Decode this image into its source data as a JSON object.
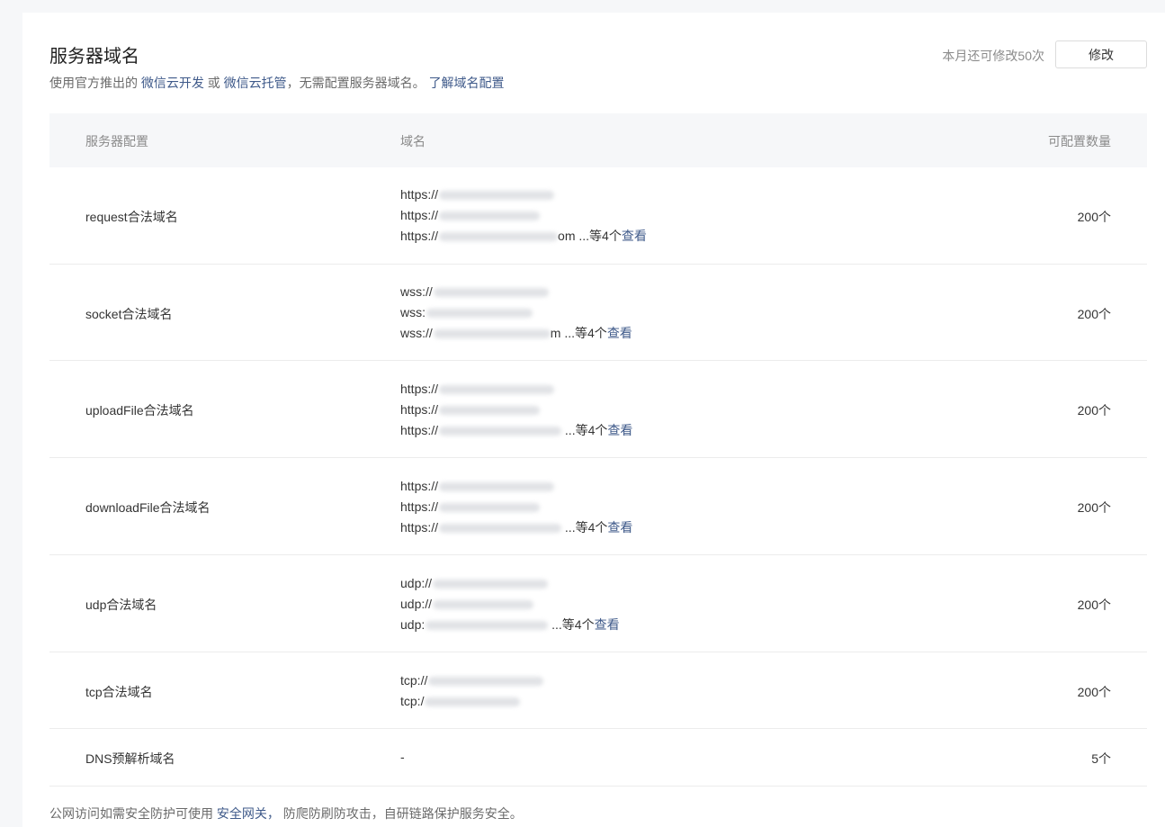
{
  "header": {
    "title": "服务器域名",
    "subtitle_prefix": "使用官方推出的",
    "link_cloud_dev": "微信云开发",
    "or_text": "或",
    "link_cloud_hosting": "微信云托管",
    "subtitle_suffix": "，无需配置服务器域名。",
    "link_learn": "了解域名配置",
    "quota_text": "本月还可修改50次",
    "edit_label": "修改"
  },
  "table": {
    "headers": {
      "config": "服务器配置",
      "domain": "域名",
      "count": "可配置数量"
    },
    "rows": [
      {
        "name": "request合法域名",
        "domains": [
          "https://",
          "https://",
          "https://"
        ],
        "tail": "om",
        "more": "...等4个",
        "view": "查看",
        "count": "200个"
      },
      {
        "name": "socket合法域名",
        "domains": [
          "wss://",
          "wss:",
          "wss://"
        ],
        "tail": "m",
        "more": "...等4个",
        "view": "查看",
        "count": "200个"
      },
      {
        "name": "uploadFile合法域名",
        "domains": [
          "https://",
          "https://",
          "https://"
        ],
        "tail": "",
        "more": "...等4个",
        "view": "查看",
        "count": "200个"
      },
      {
        "name": "downloadFile合法域名",
        "domains": [
          "https://",
          "https://",
          "https://"
        ],
        "tail": "",
        "more": "...等4个",
        "view": "查看",
        "count": "200个"
      },
      {
        "name": "udp合法域名",
        "domains": [
          "udp://",
          "udp://",
          "udp:"
        ],
        "tail": "",
        "more": "...等4个",
        "view": "查看",
        "count": "200个"
      },
      {
        "name": "tcp合法域名",
        "domains": [
          "tcp://",
          "tcp:/"
        ],
        "count": "200个"
      },
      {
        "name": "DNS预解析域名",
        "domain_text": "-",
        "count": "5个"
      }
    ]
  },
  "footer": {
    "prefix": "公网访问如需安全防护可使用",
    "link": "安全网关，",
    "suffix": "防爬防刷防攻击，自研链路保护服务安全。"
  }
}
